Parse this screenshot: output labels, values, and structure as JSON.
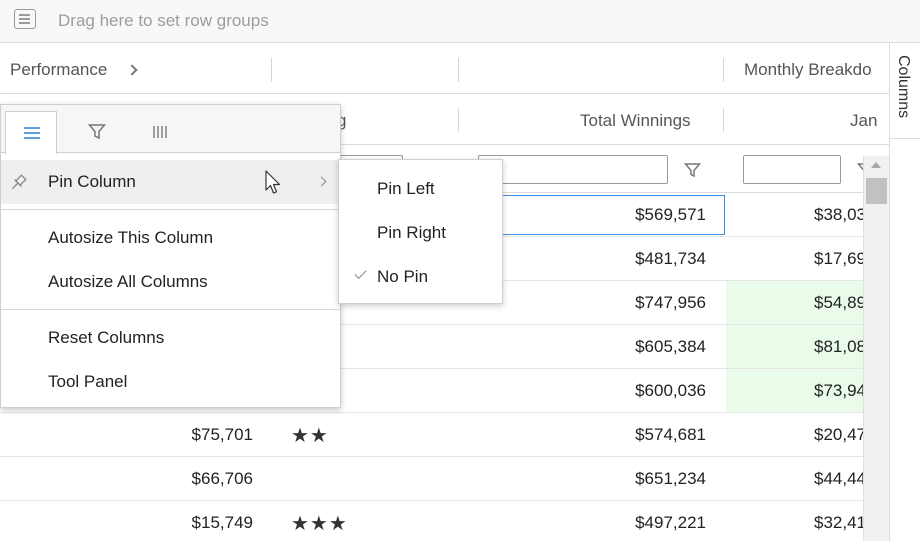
{
  "row_group_bar": {
    "placeholder": "Drag here to set row groups"
  },
  "group_headers": {
    "performance": "Performance",
    "monthly": "Monthly Breakdo"
  },
  "column_headers": {
    "partial": "g",
    "total_winnings": "Total Winnings",
    "jan": "Jan"
  },
  "rows": [
    {
      "total_winnings": "$569,571",
      "jan": "$38,03",
      "jan_highlight": false
    },
    {
      "total_winnings": "$481,734",
      "jan": "$17,69",
      "jan_highlight": false
    },
    {
      "total_winnings": "$747,956",
      "jan": "$54,89",
      "jan_highlight": true
    },
    {
      "total_winnings": "$605,384",
      "jan": "$81,08",
      "jan_highlight": true
    },
    {
      "total_winnings": "$600,036",
      "jan": "$73,94",
      "jan_highlight": true
    },
    {
      "prev_value": "$75,701",
      "rating": "★★",
      "total_winnings": "$574,681",
      "jan": "$20,47",
      "jan_highlight": false
    },
    {
      "prev_value": "$66,706",
      "rating": "",
      "total_winnings": "$651,234",
      "jan": "$44,44",
      "jan_highlight": false
    },
    {
      "prev_value": "$15,749",
      "rating": "★★★",
      "total_winnings": "$497,221",
      "jan": "$32,41",
      "jan_highlight": false
    }
  ],
  "side_panel": {
    "columns_tab": "Columns"
  },
  "column_menu": {
    "tabs": [
      {
        "icon": "menu-lines-icon",
        "active": true
      },
      {
        "icon": "filter-icon",
        "active": false
      },
      {
        "icon": "columns-icon",
        "active": false
      }
    ],
    "items": {
      "pin_column": "Pin Column",
      "autosize_this": "Autosize This Column",
      "autosize_all": "Autosize All Columns",
      "reset_columns": "Reset Columns",
      "tool_panel": "Tool Panel"
    },
    "pin_submenu": {
      "pin_left": "Pin Left",
      "pin_right": "Pin Right",
      "no_pin": "No Pin",
      "selected": "no_pin"
    }
  },
  "colors": {
    "accent_focus": "#3a8ee6",
    "highlight_green": "#eafbea",
    "menu_hover": "#efefef"
  }
}
